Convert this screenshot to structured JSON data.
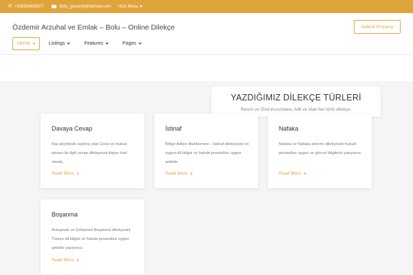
{
  "topbar": {
    "phone": "+905584859877",
    "email": "Bolu_govemli@hotmail.com",
    "quick_menu": "Hızlı Menu"
  },
  "header": {
    "site_title": "Özdemir Arzuhal ve Emlak – Bolu – Online Dilekçe",
    "submit_label": "Submit Property"
  },
  "nav": {
    "items": [
      {
        "label": "Home"
      },
      {
        "label": "Listings"
      },
      {
        "label": "Features"
      },
      {
        "label": "Pages"
      }
    ]
  },
  "section": {
    "title": "YAZDIĞIMIZ DİLEKÇE TÜRLERİ",
    "subtitle": "Resmi ve Özel Kurumlara, Adli ve İdari her türlü dilekçe."
  },
  "cards": [
    {
      "title": "Davaya Cevap",
      "text": "Kişi aleyhinde açılmış olan Ceza ve Hukuk davası ile ilgili cevap dilekçesini kişiye özel olarak,",
      "link": "Read More"
    },
    {
      "title": "İstinaf",
      "text": "Bölge Adliye Mahkemesi – İstinaf dilekçesini en uygun dil bilgisi ve hukuki prosedüre uygun şekilde",
      "link": "Read More"
    },
    {
      "title": "Nafaka",
      "text": "Nafaka ve Nafaka artırımı dilekçesini hukuki prosedüre uygun ve güncel bilgilerle yazıyoruz.",
      "link": "Read More"
    },
    {
      "title": "Boşanma",
      "text": "Anlaşmalı ve Çekişmeli Boşanma dilekçesini Türkçe dil bilgisi ve hukuki prosedüre uygun şekilde yazıyoruz.",
      "link": "Read More"
    }
  ],
  "colors": {
    "accent": "#e0a53a"
  }
}
